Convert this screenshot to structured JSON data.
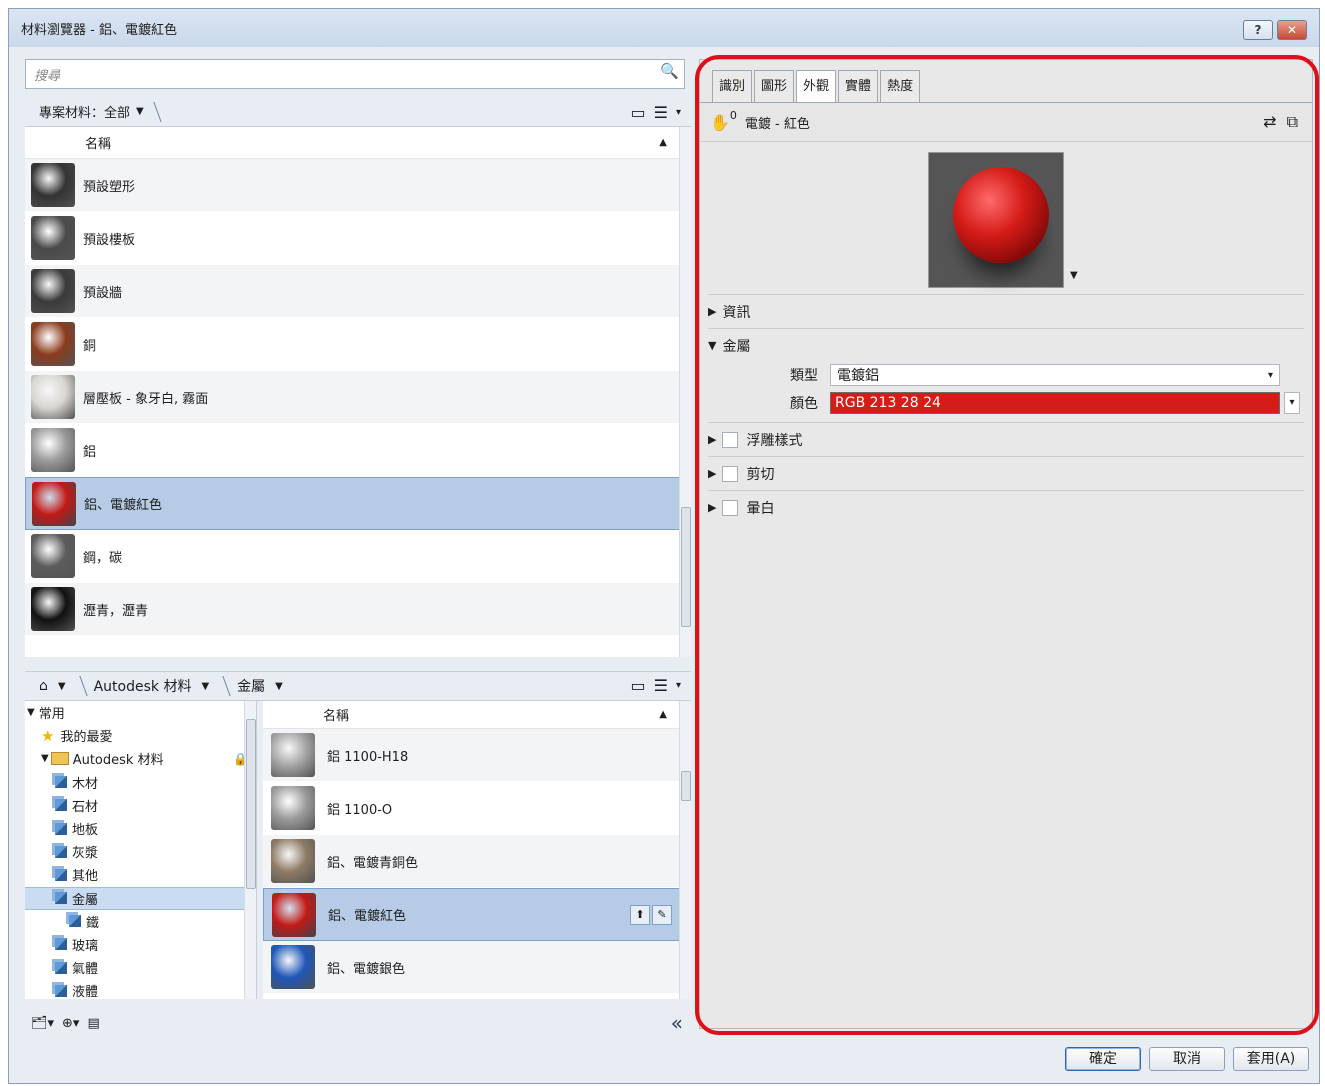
{
  "window": {
    "title": "材料瀏覽器 - 鋁、電鍍紅色",
    "help": "?",
    "close": "✕"
  },
  "search": {
    "placeholder": "搜尋"
  },
  "project_bar": {
    "label": "專案材料：全部"
  },
  "project_table": {
    "header": "名稱",
    "rows": [
      {
        "name": "預設塑形",
        "thumb_color": "#333333"
      },
      {
        "name": "預設樓板",
        "thumb_color": "#4a4a4a"
      },
      {
        "name": "預設牆",
        "thumb_color": "#3a3a3a"
      },
      {
        "name": "銅",
        "thumb_color": "#8a3b1d"
      },
      {
        "name": "層壓板 - 象牙白, 霧面",
        "thumb_color": "#d9d6d0"
      },
      {
        "name": "鋁",
        "thumb_color": "#9b9b9b"
      },
      {
        "name": "鋁、電鍍紅色",
        "thumb_color": "#c21a16"
      },
      {
        "name": "鋼，碳",
        "thumb_color": "#5c5c5c"
      },
      {
        "name": "瀝青，瀝青",
        "thumb_color": "#111111"
      }
    ]
  },
  "library_bar": {
    "library": "Autodesk 材料",
    "category": "金屬"
  },
  "library_tree": [
    {
      "label": "常用",
      "level": 0,
      "kind": "caret"
    },
    {
      "label": "我的最愛",
      "level": 1,
      "kind": "star"
    },
    {
      "label": "Autodesk 材料",
      "level": 1,
      "kind": "folder"
    },
    {
      "label": "木材",
      "level": 2,
      "kind": "cube"
    },
    {
      "label": "石材",
      "level": 2,
      "kind": "cube"
    },
    {
      "label": "地板",
      "level": 2,
      "kind": "cube"
    },
    {
      "label": "灰漿",
      "level": 2,
      "kind": "cube"
    },
    {
      "label": "其他",
      "level": 2,
      "kind": "cube"
    },
    {
      "label": "金屬",
      "level": 2,
      "kind": "cube"
    },
    {
      "label": "鐵",
      "level": 3,
      "kind": "cube"
    },
    {
      "label": "玻璃",
      "level": 2,
      "kind": "cube"
    },
    {
      "label": "氣體",
      "level": 2,
      "kind": "cube"
    },
    {
      "label": "液體",
      "level": 2,
      "kind": "cube"
    }
  ],
  "library_table": {
    "header": "名稱",
    "rows": [
      {
        "name": "鋁 1100-H18",
        "thumb_color": "#a5a5a5"
      },
      {
        "name": "鋁 1100-O",
        "thumb_color": "#9c9c9c"
      },
      {
        "name": "鋁、電鍍青銅色",
        "thumb_color": "#8f7b66"
      },
      {
        "name": "鋁、電鍍紅色",
        "thumb_color": "#c21a16"
      },
      {
        "name": "鋁、電鍍銀色",
        "thumb_color": "#1f56b8"
      }
    ]
  },
  "tabs": [
    "識別",
    "圖形",
    "外觀",
    "實體",
    "熱度"
  ],
  "asset": {
    "count": "0",
    "name": "電鍍 - 紅色"
  },
  "sections": {
    "info": "資訊",
    "metal": "金屬",
    "relief": "浮雕樣式",
    "cutout": "剪切",
    "bleach": "暈白"
  },
  "properties": {
    "type_label": "類型",
    "type_value": "電鍍鋁",
    "color_label": "顏色",
    "color_value": "RGB 213 28 24"
  },
  "footer": {
    "ok": "確定",
    "cancel": "取消",
    "apply": "套用(A)"
  },
  "colors": {
    "accent_red": "#d51c18",
    "selection": "#b6cce6",
    "outline": "#e0101a"
  }
}
